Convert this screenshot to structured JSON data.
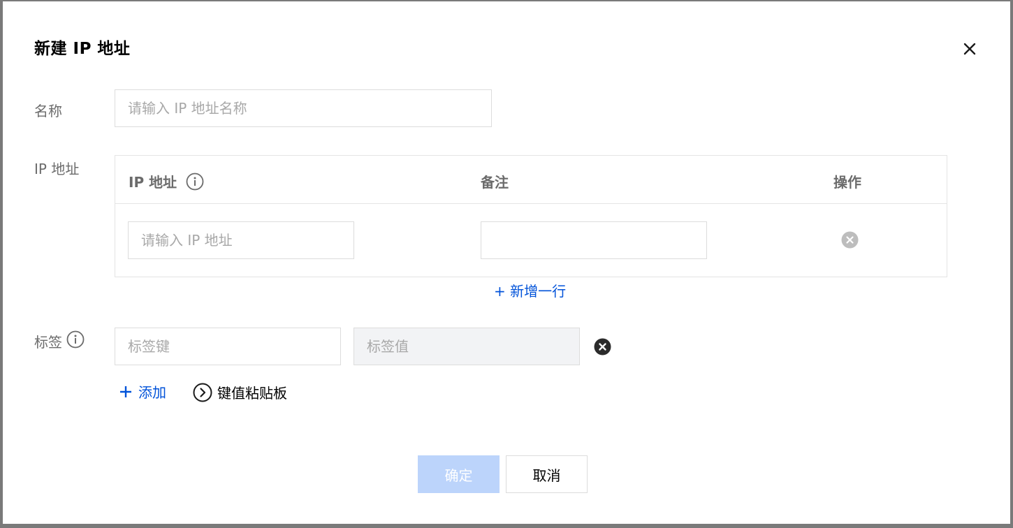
{
  "dialog": {
    "title": "新建 IP 地址",
    "close_icon": "close-icon"
  },
  "form": {
    "name": {
      "label": "名称",
      "placeholder": "请输入 IP 地址名称",
      "value": ""
    },
    "ip": {
      "label": "IP 地址",
      "table": {
        "headers": {
          "ip": "IP 地址",
          "remark": "备注",
          "action": "操作"
        },
        "rows": [
          {
            "ip_placeholder": "请输入 IP 地址",
            "ip_value": "",
            "remark_value": ""
          }
        ],
        "add_row": "+ 新增一行"
      }
    },
    "tags": {
      "label": "标签",
      "key_placeholder": "标签键",
      "value_placeholder": "标签值",
      "add_label": "添加",
      "clipboard_label": "键值粘贴板"
    }
  },
  "footer": {
    "confirm_label": "确定",
    "cancel_label": "取消"
  },
  "colors": {
    "link": "#0052d9",
    "primary_disabled": "#bcd4fb",
    "muted_text": "#6b6b6b"
  }
}
